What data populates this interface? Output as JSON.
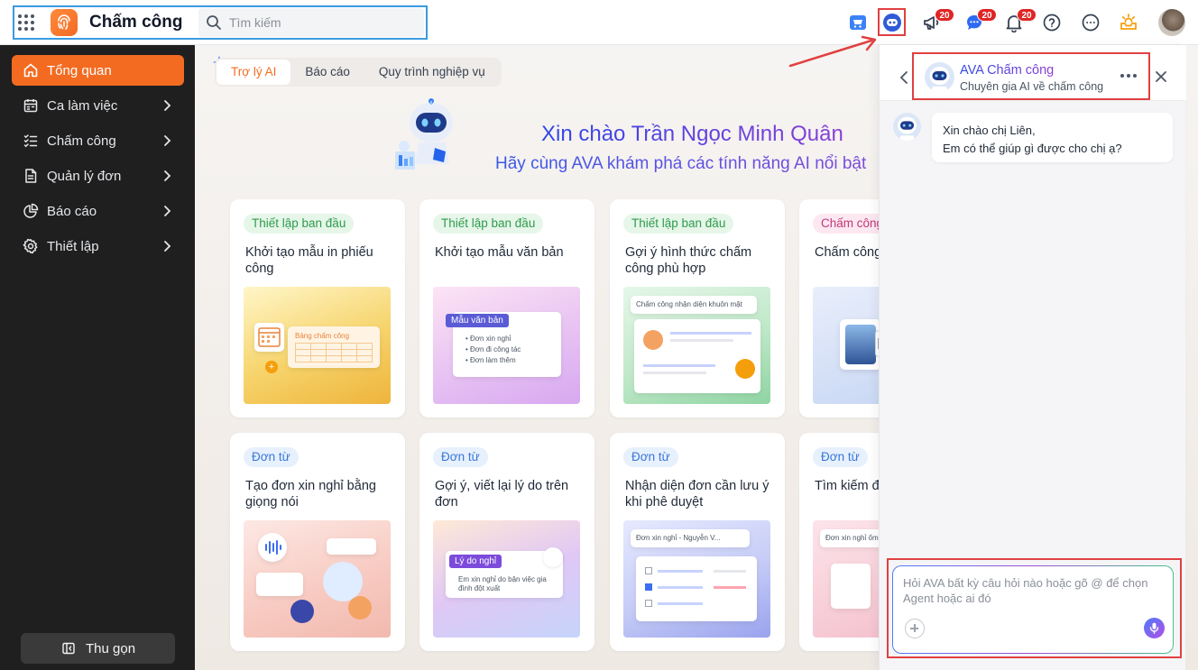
{
  "app": {
    "title": "Chấm công"
  },
  "search": {
    "placeholder": "Tìm kiếm"
  },
  "header": {
    "badges": {
      "announcements": "20",
      "messages": "20",
      "notifications": "20"
    }
  },
  "sidebar": {
    "items": [
      {
        "label": "Tổng quan"
      },
      {
        "label": "Ca làm việc"
      },
      {
        "label": "Chấm công"
      },
      {
        "label": "Quản lý đơn"
      },
      {
        "label": "Báo cáo"
      },
      {
        "label": "Thiết lập"
      }
    ],
    "collapse_label": "Thu gọn"
  },
  "main": {
    "tabs": [
      {
        "label": "Trợ lý AI"
      },
      {
        "label": "Báo cáo"
      },
      {
        "label": "Quy trình nghiệp vụ"
      }
    ],
    "greeting": "Xin chào Trần Ngọc Minh Quân",
    "subgreeting": "Hãy cùng AVA khám phá các tính năng AI nổi bật",
    "cards": [
      {
        "tag": "Thiết lập ban đầu",
        "title": "Khởi tạo mẫu in phiếu công",
        "illus_text": "Bảng chấm công"
      },
      {
        "tag": "Thiết lập ban đầu",
        "title": "Khởi tạo mẫu văn bản",
        "illus_title": "Mẫu văn bản",
        "illus_items": [
          "Đơn xin nghỉ",
          "Đơn đi công tác",
          "Đơn làm thêm"
        ]
      },
      {
        "tag": "Thiết lập ban đầu",
        "title": "Gợi ý hình thức chấm công phù hợp",
        "illus_text": "Chấm công nhận diện khuôn mặt"
      },
      {
        "tag": "Chấm công",
        "title": "Chấm công trên ứng dụng"
      },
      {
        "tag": "Đơn từ",
        "title": "Tạo đơn xin nghỉ bằng giọng nói"
      },
      {
        "tag": "Đơn từ",
        "title": "Gợi ý, viết lại lý do trên đơn",
        "illus_title": "Lý do nghỉ",
        "illus_text": "Em xin nghỉ do bận việc gia đình đột xuất"
      },
      {
        "tag": "Đơn từ",
        "title": "Nhận diện đơn cần lưu ý khi phê duyệt",
        "illus_text": "Đơn xin nghỉ - Nguyễn V..."
      },
      {
        "tag": "Đơn từ",
        "title": "Tìm kiếm đơn hoạt",
        "illus_text": "Đơn xin nghỉ ốm"
      }
    ]
  },
  "chat": {
    "agent_name": "AVA Chấm công",
    "agent_desc": "Chuyên gia AI về chấm công",
    "message_line1": "Xin chào chị Liên,",
    "message_line2": "Em có thể giúp gì được cho chị ạ?",
    "input_placeholder": "Hỏi AVA bất kỳ câu hỏi nào hoặc gõ @ để chọn Agent hoặc ai đó"
  },
  "colors": {
    "accent": "#f36b21",
    "ai_blue": "#3a57e8",
    "ai_purple": "#8a3fd6",
    "annotation_red": "#e04040"
  }
}
